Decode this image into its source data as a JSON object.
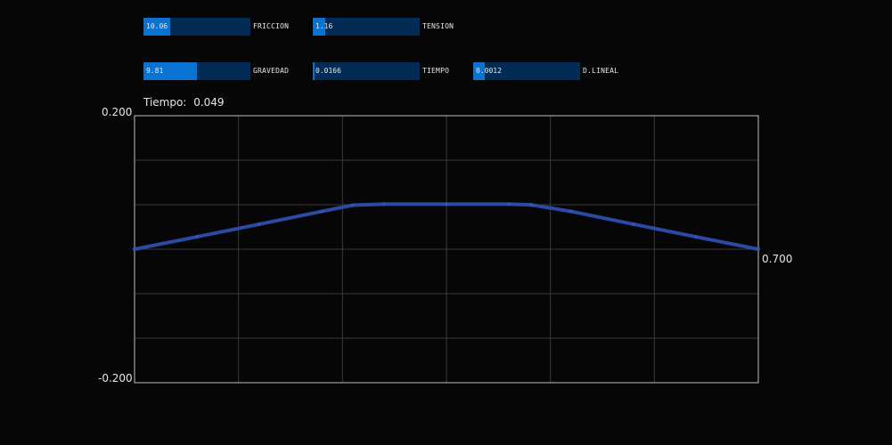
{
  "sliders": [
    {
      "id": "friccion",
      "value": "10.06",
      "label": "FRICCION",
      "fraction": 0.25
    },
    {
      "id": "tension",
      "value": "1.16",
      "label": "TENSION",
      "fraction": 0.12
    },
    {
      "id": "gravedad",
      "value": "9.81",
      "label": "GRAVEDAD",
      "fraction": 0.5
    },
    {
      "id": "tiempo",
      "value": "0.0166",
      "label": "TIEMPO",
      "fraction": 0.015
    },
    {
      "id": "dlineal",
      "value": "0.0012",
      "label": "D.LINEAL",
      "fraction": 0.11
    }
  ],
  "time_display": {
    "label": "Tiempo:",
    "value": "0.049"
  },
  "chart_data": {
    "type": "line",
    "ylim": [
      -0.2,
      0.2
    ],
    "xlim": [
      0,
      0.7
    ],
    "y_max_label": "0.200",
    "y_min_label": "-0.200",
    "x_max_label": "0.700",
    "grid": true,
    "grid_divisions": {
      "x": 6,
      "y": 6
    },
    "series": [
      {
        "color": "#2a4aa3",
        "x": [
          0,
          0.07,
          0.14,
          0.21,
          0.245,
          0.28,
          0.35,
          0.42,
          0.445,
          0.49,
          0.56,
          0.63,
          0.7
        ],
        "y": [
          0,
          0.0185,
          0.0375,
          0.0565,
          0.066,
          0.0675,
          0.0675,
          0.0675,
          0.0665,
          0.0565,
          0.0375,
          0.0185,
          0
        ]
      }
    ]
  },
  "colors": {
    "background": "#060606",
    "slider_track": "#022b56",
    "slider_fill": "#0a73d2",
    "grid_line": "#3a3a3a",
    "frame": "#bdbdbd",
    "line": "#2a4aa3"
  }
}
